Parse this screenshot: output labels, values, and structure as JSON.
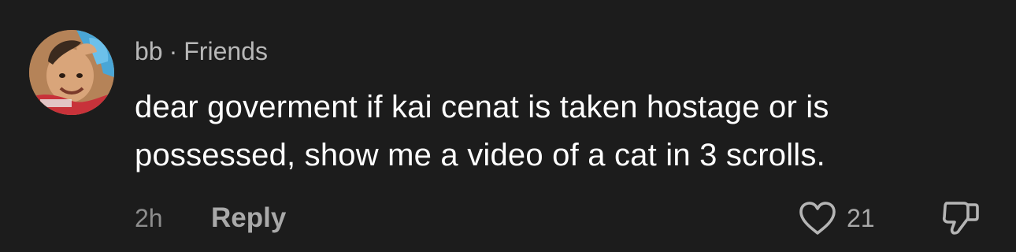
{
  "comment": {
    "username": "bb",
    "separator": "·",
    "relation": "Friends",
    "text": "dear goverment if kai cenat is taken hostage or is possessed, show me a video of a cat in 3 scrolls.",
    "time_ago": "2h",
    "reply_label": "Reply",
    "like_count": "21",
    "icons": {
      "like": "heart-outline-icon",
      "dislike": "thumbs-down-outline-icon"
    }
  },
  "colors": {
    "background": "#1c1c1c",
    "username": "#b8b8b8",
    "body_text": "#ffffff",
    "meta_text": "#8d8d8d",
    "action_text": "#a9a9a9"
  }
}
